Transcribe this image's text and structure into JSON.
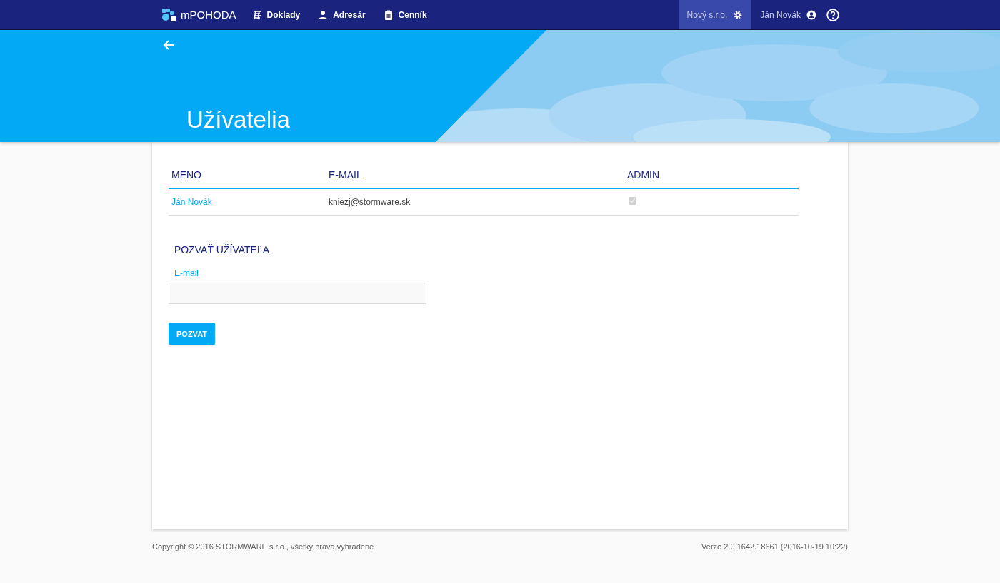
{
  "topbar": {
    "brand": "mPOHODA",
    "nav": [
      {
        "label": "Doklady",
        "kind": "documents"
      },
      {
        "label": "Adresár",
        "kind": "contacts"
      },
      {
        "label": "Cenník",
        "kind": "pricelist"
      }
    ],
    "company": {
      "label": "Nový s.r.o.",
      "selected": true
    },
    "user": {
      "label": "Ján Novák",
      "selected": false
    }
  },
  "hero": {
    "title": "Užívatelia"
  },
  "table": {
    "columns": [
      "MENO",
      "E-MAIL",
      "ADMIN"
    ],
    "rows": [
      {
        "name": "Ján Novák",
        "email": "kniezj@stormware.sk",
        "admin": {
          "checked": true,
          "disabled": true
        }
      }
    ]
  },
  "invite": {
    "heading": "POZVAŤ UŽÍVATEĽA",
    "field_label": "E-mail",
    "button": "POZVAT"
  },
  "footer": {
    "copyright": "Copyright © 2016 STORMWARE s.r.o., všetky práva vyhradené",
    "version": "Verze 2.0.1642.18661 (2016-10-19 10:22)"
  }
}
